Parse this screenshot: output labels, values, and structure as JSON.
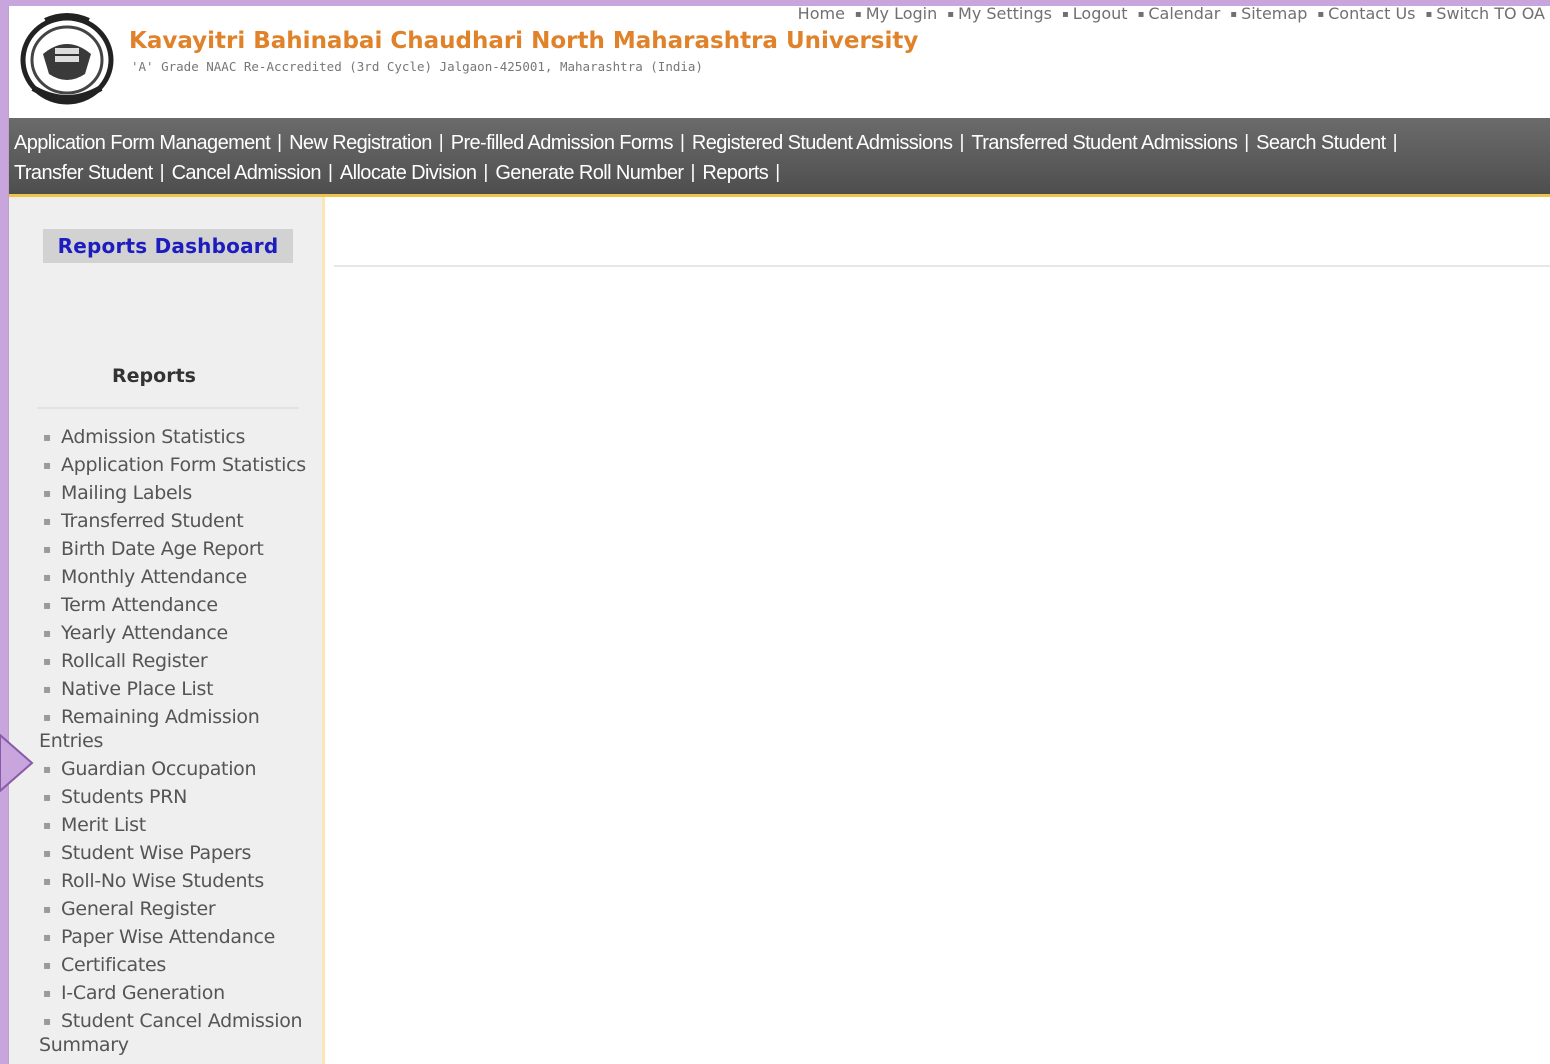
{
  "header": {
    "university_name": "Kavayitri Bahinabai Chaudhari North Maharashtra University",
    "university_subtitle": "'A' Grade NAAC Re-Accredited (3rd Cycle) Jalgaon-425001, Maharashtra (India)",
    "logo_icon": "university-seal-icon",
    "top_links": [
      "Home",
      "My Login",
      "My Settings",
      "Logout",
      "Calendar",
      "Sitemap",
      "Contact Us",
      "Switch TO OA"
    ]
  },
  "nav": {
    "row1": [
      "Application Form Management",
      "New Registration",
      "Pre-filled Admission Forms",
      "Registered Student Admissions",
      "Transferred Student Admissions",
      "Search Student"
    ],
    "row2": [
      "Transfer Student",
      "Cancel Admission",
      "Allocate Division",
      "Generate Roll Number",
      "Reports"
    ],
    "separator": "|"
  },
  "sidebar": {
    "dashboard_title": "Reports Dashboard",
    "reports_heading": "Reports",
    "bullet": "▪",
    "items": [
      "Admission Statistics",
      "Application Form Statistics",
      "Mailing Labels",
      "Transferred Student",
      "Birth Date Age Report",
      "Monthly Attendance",
      "Term Attendance",
      "Yearly Attendance",
      "Rollcall Register",
      "Native Place List",
      "Remaining Admission Entries",
      "Guardian Occupation",
      "Students PRN",
      "Merit List",
      "Student Wise Papers",
      "Roll-No Wise Students",
      "General Register",
      "Paper Wise Attendance",
      "Certificates",
      "I-Card Generation",
      "Student Cancel Admission Summary"
    ]
  },
  "colors": {
    "accent_orange": "#e0822a",
    "nav_bg": "#5a5a5a",
    "nav_border": "#f0c44a",
    "dashboard_text": "#1c1cbf",
    "page_border": "#c9a5dd"
  }
}
